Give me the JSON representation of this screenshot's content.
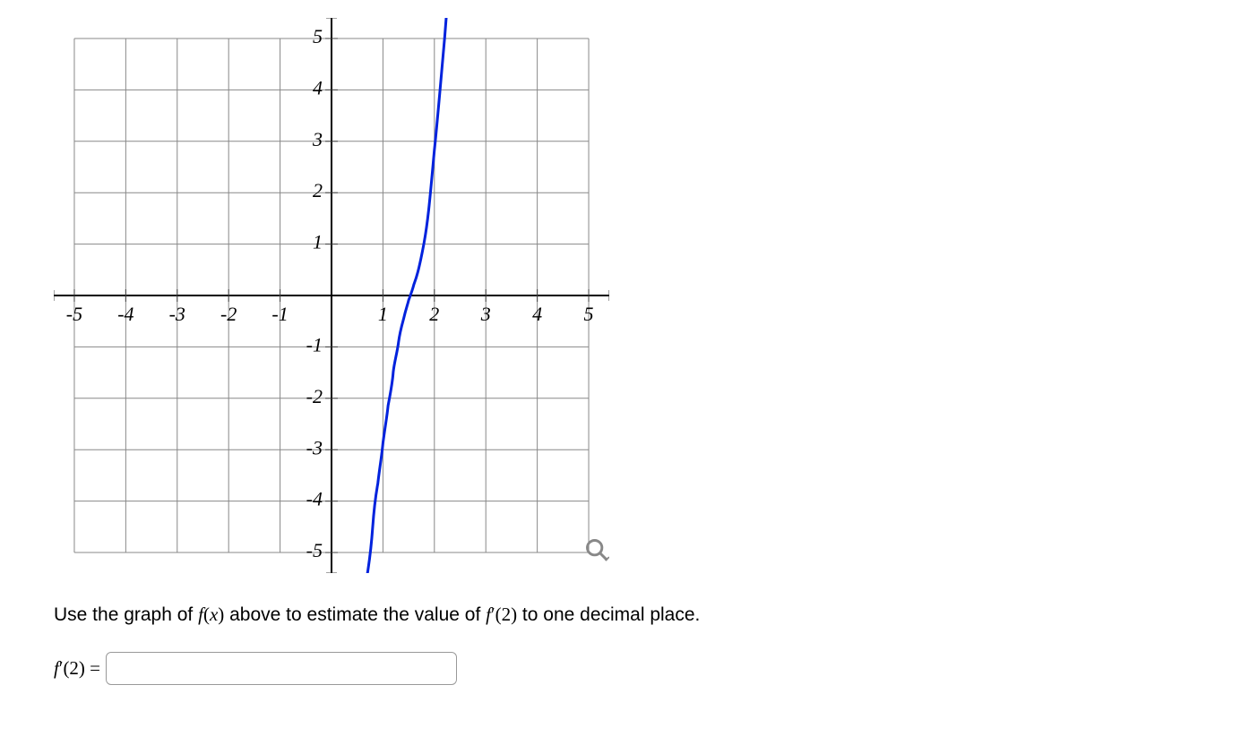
{
  "chart_data": {
    "type": "line",
    "title": "",
    "xlabel": "",
    "ylabel": "",
    "xlim": [
      -5.4,
      5.4
    ],
    "ylim": [
      -5.4,
      5.4
    ],
    "x_ticks": [
      -5,
      -4,
      -3,
      -2,
      -1,
      1,
      2,
      3,
      4,
      5
    ],
    "y_ticks": [
      -5,
      -4,
      -3,
      -2,
      -1,
      1,
      2,
      3,
      4,
      5
    ],
    "x_tick_labels": [
      "-5",
      "-4",
      "-3",
      "-2",
      "-1",
      "1",
      "2",
      "3",
      "4",
      "5"
    ],
    "y_tick_labels": [
      "-5",
      "-4",
      "-3",
      "-2",
      "-1",
      "1",
      "2",
      "3",
      "4",
      "5"
    ],
    "grid": true,
    "series": [
      {
        "name": "f(x)",
        "color": "#0022dd",
        "x": [
          0.7,
          0.8,
          0.9,
          1.0,
          1.1,
          1.2,
          1.3,
          1.4,
          1.5,
          1.6,
          1.7,
          1.8,
          1.9,
          2.0,
          2.1,
          2.2,
          2.3,
          2.358
        ],
        "y": [
          -5.4,
          -4.51,
          -3.66,
          -2.87,
          -2.14,
          -1.49,
          -0.93,
          -0.46,
          -0.09,
          0.21,
          0.54,
          1.03,
          1.8,
          2.83,
          3.95,
          5.0,
          5.98,
          6.55
        ]
      }
    ]
  },
  "question": {
    "prompt_pre": "Use the graph of ",
    "prompt_fx": "f(x)",
    "prompt_mid": " above to estimate the value of ",
    "prompt_deriv": "f′(2)",
    "prompt_post": " to one decimal place.",
    "answer_label_lhs_f": "f",
    "answer_label_lhs_prime": "′",
    "answer_label_lhs_arg": "(2) = ",
    "answer_value": "",
    "answer_placeholder": ""
  },
  "icons": {
    "zoom": "zoom-icon"
  }
}
